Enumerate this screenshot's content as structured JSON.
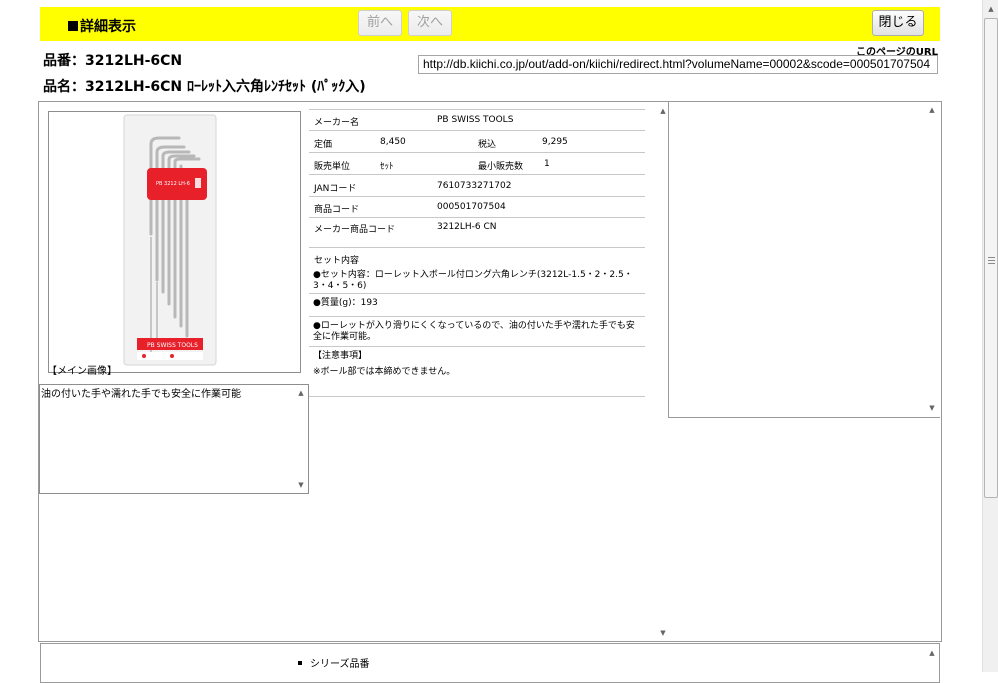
{
  "header": {
    "title": "詳細表示",
    "prev_label": "前へ",
    "next_label": "次へ",
    "close_label": "閉じる"
  },
  "page_url": {
    "label": "このページのURL",
    "value": "http://db.kiichi.co.jp/out/add-on/kiichi/redirect.html?volumeName=00002&scode=000501707504"
  },
  "product": {
    "hinban": "品番：3212LH-6CN",
    "hinmei": "品名：3212LH-6CN ﾛｰﾚｯﾄ入六角ﾚﾝﾁｾｯﾄ (ﾊﾟｯｸ入)"
  },
  "image": {
    "caption": "【メイン画像】",
    "package_brand": "PB SWISS TOOLS",
    "colors": {
      "package": "#e8202a",
      "background": "#f2f2f2"
    }
  },
  "description": "油の付いた手や濡れた手でも安全に作業可能",
  "spec": {
    "maker_label": "メーカー名",
    "maker_value": "PB SWISS TOOLS",
    "price_label": "定価",
    "price_value": "8,450",
    "tax_label": "税込",
    "tax_value": "9,295",
    "unit_label": "販売単位",
    "unit_value": "ｾｯﾄ",
    "min_label": "最小販売数",
    "min_value": "1",
    "jan_label": "JANコード",
    "jan_value": "7610733271702",
    "code_label": "商品コード",
    "code_value": "000501707504",
    "maker_code_label": "メーカー商品コード",
    "maker_code_value": "3212LH-6 CN",
    "set_label": "セット内容",
    "notes": [
      "●セット内容：ローレット入ボール付ロング六角レンチ(3212L-1.5・2・2.5・3・4・5・6)",
      "●質量(g)：193",
      "●ローレットが入り滑りにくくなっているので、油の付いた手や濡れた手でも安全に作業可能。"
    ],
    "caution_label": "【注意事項】",
    "caution_text": "※ボール部では本締めできません。"
  },
  "series": {
    "label": "シリーズ品番"
  }
}
